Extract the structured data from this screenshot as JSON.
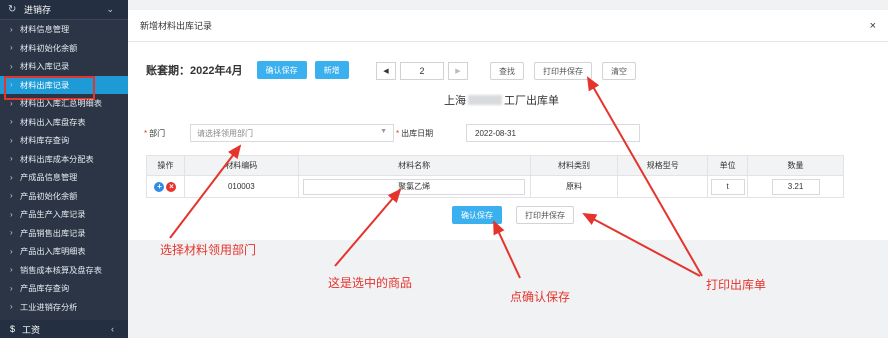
{
  "sidebar": {
    "header": "进销存",
    "items": [
      {
        "label": "材料信息管理"
      },
      {
        "label": "材料初始化余额"
      },
      {
        "label": "材料入库记录"
      },
      {
        "label": "材料出库记录",
        "active": true
      },
      {
        "label": "材料出入库汇总明细表"
      },
      {
        "label": "材料出入库盘存表"
      },
      {
        "label": "材料库存查询"
      },
      {
        "label": "材料出库成本分配表"
      },
      {
        "label": "产成品信息管理"
      },
      {
        "label": "产品初始化余额"
      },
      {
        "label": "产品生产入库记录"
      },
      {
        "label": "产品销售出库记录"
      },
      {
        "label": "产品出入库明细表"
      },
      {
        "label": "销售成本核算及盘存表"
      },
      {
        "label": "产品库存查询"
      },
      {
        "label": "工业进销存分析"
      }
    ],
    "footer": "工资"
  },
  "modal": {
    "title": "新增材料出库记录",
    "close": "×"
  },
  "toolbar": {
    "period": "账套期：2022年4月",
    "confirm_save": "确认保存",
    "add": "新增",
    "page": "2",
    "find": "查找",
    "print_save": "打印并保存",
    "clear": "清空"
  },
  "doc": {
    "title_prefix": "上海",
    "title_suffix": "工厂出库单"
  },
  "form": {
    "dept_label": "部门",
    "dept_placeholder": "请选择领用部门",
    "date_label": "出库日期",
    "date_value": "2022-08-31"
  },
  "table": {
    "headers": [
      "操作",
      "材料编码",
      "材料名称",
      "材料类别",
      "规格型号",
      "单位",
      "数量"
    ],
    "rows": [
      {
        "code": "010003",
        "name": "聚氯乙烯",
        "category": "原料",
        "spec": "",
        "unit": "t",
        "qty": "3.21"
      }
    ]
  },
  "bottom": {
    "confirm_save": "确认保存",
    "print_save": "打印并保存"
  },
  "annotations": {
    "dept": "选择材料领用部门",
    "item": "这是选中的商品",
    "save": "点确认保存",
    "print": "打印出库单"
  },
  "colors": {
    "accent": "#3ab0ef",
    "annotation": "#e5342c",
    "sidebar_bg": "#2b3545",
    "active_item": "#1e9bd7"
  }
}
